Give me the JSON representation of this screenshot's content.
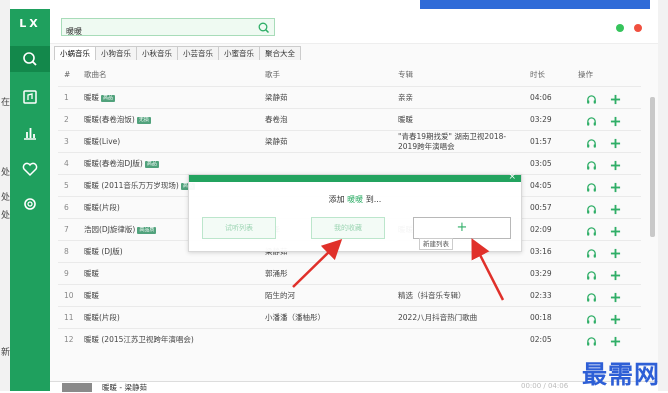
{
  "app": {
    "logo": "LX"
  },
  "search": {
    "value": "暖暖",
    "placeholder": ""
  },
  "tabs": [
    "小蜗音乐",
    "小狗音乐",
    "小秋音乐",
    "小芸音乐",
    "小蜜音乐",
    "聚合大全"
  ],
  "columns": {
    "index": "#",
    "song": "歌曲名",
    "singer": "歌手",
    "album": "专辑",
    "duration": "时长",
    "actions": "操作"
  },
  "rows": [
    {
      "index": "1",
      "song": "暖暖",
      "tag": "高品",
      "singer": "梁静茹",
      "album": "亲亲",
      "duration": "04:06"
    },
    {
      "index": "2",
      "song": "暖暖(春卷泡饭)",
      "tag": "无损",
      "singer": "春卷泡",
      "album": "暖暖",
      "duration": "03:29"
    },
    {
      "index": "3",
      "song": "暖暖(Live)",
      "tag": "",
      "singer": "梁静茹",
      "album": "\"青春19期找爱\" 湖南卫视2018-2019跨年演唱会",
      "duration": "01:57"
    },
    {
      "index": "4",
      "song": "暖暖(春卷泡DJ版)",
      "tag": "高品",
      "singer": "",
      "album": "",
      "duration": "03:05"
    },
    {
      "index": "5",
      "song": "暖暖 (2011音乐万万岁现场)",
      "tag": "高品",
      "singer": "",
      "album": "",
      "duration": "04:05"
    },
    {
      "index": "6",
      "song": "暖暖(片段)",
      "tag": "",
      "singer": "",
      "album": "",
      "duration": "00:57"
    },
    {
      "index": "7",
      "song": "浩园(DJ旋律版)",
      "tag": "高品质",
      "singer": "阿泽",
      "album": "暖暖",
      "duration": "02:09"
    },
    {
      "index": "8",
      "song": "暖暖 (DJ版)",
      "tag": "",
      "singer": "梁静茹",
      "album": "",
      "duration": "03:16"
    },
    {
      "index": "9",
      "song": "暖暖",
      "tag": "",
      "singer": "郭涌彤",
      "album": "",
      "duration": "03:29"
    },
    {
      "index": "10",
      "song": "暖暖",
      "tag": "",
      "singer": "陌生的河",
      "album": "精选（抖音乐专辑）",
      "duration": "02:33"
    },
    {
      "index": "11",
      "song": "暖暖(片段)",
      "tag": "",
      "singer": "小潘潘（潘柚彤）",
      "album": "2022八月抖音热门歌曲",
      "duration": "00:18"
    },
    {
      "index": "12",
      "song": "暖暖 (2015江苏卫视跨年演唱会)",
      "tag": "",
      "singer": "",
      "album": "",
      "duration": "02:05"
    }
  ],
  "modal": {
    "prefix": "添加",
    "song": "暖暖",
    "suffix": "到...",
    "close": "×",
    "buttons": [
      "试听列表",
      "我的收藏"
    ],
    "new_plus": "+",
    "new_label": "新建列表"
  },
  "footer": {
    "now_playing": "暖暖 - 梁静茹",
    "time": "00:00 / 04:06"
  },
  "watermark": "最需网",
  "colors": {
    "accent": "#1fa05e",
    "sidebar_active": "#13884b",
    "dot_green": "#36c45c",
    "dot_red": "#f0503f",
    "arrow": "#e0302a"
  },
  "icons": [
    "search-icon",
    "music-library-icon",
    "chart-icon",
    "heart-icon",
    "settings-icon",
    "headphones-icon",
    "plus-icon"
  ]
}
